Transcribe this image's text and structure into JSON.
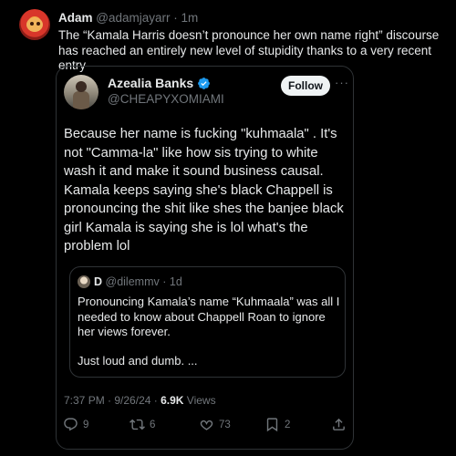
{
  "outer_post": {
    "name": "Adam",
    "handle": "@adamjayarr",
    "separator": "·",
    "time": "1m",
    "text": "The “Kamala Harris doesn’t pronounce her own name right” discourse has reached an entirely new level of stupidity thanks to a very recent entry"
  },
  "quoted_post": {
    "name": "Azealia Banks",
    "handle": "@CHEAPYXOMIAMI",
    "follow_label": "Follow",
    "more_label": "···",
    "text": "Because her name is fucking \"kuhmaala\" . It's not \"Camma-la\" like how sis trying to white wash it and make it sound business causal. Kamala keeps saying she's black Chappell is pronouncing the shit like shes the banjee black girl Kamala is saying she is lol what's the problem lol",
    "meta": {
      "time": "7:37 PM",
      "separator": " · ",
      "date": "9/26/24",
      "views_count": "6.9K",
      "views_label": "Views"
    },
    "actions": {
      "replies": "9",
      "reposts": "6",
      "likes": "73",
      "bookmarks": "2"
    }
  },
  "nested_quote": {
    "name": "D",
    "handle": "@dilemmv",
    "separator": "·",
    "time": "1d",
    "text": "Pronouncing Kamala’s name “Kuhmaala” was all I needed to know about Chappell Roan to ignore her views forever.",
    "text2": "Just loud and dumb. ..."
  },
  "colors": {
    "background": "#000000",
    "text": "#e7e9ea",
    "secondary": "#71767b",
    "border": "#2f3336",
    "verified": "#1d9bf0"
  },
  "icons": [
    "verified-badge-icon",
    "more-icon",
    "reply-icon",
    "repost-icon",
    "like-icon",
    "bookmark-icon",
    "share-icon"
  ]
}
